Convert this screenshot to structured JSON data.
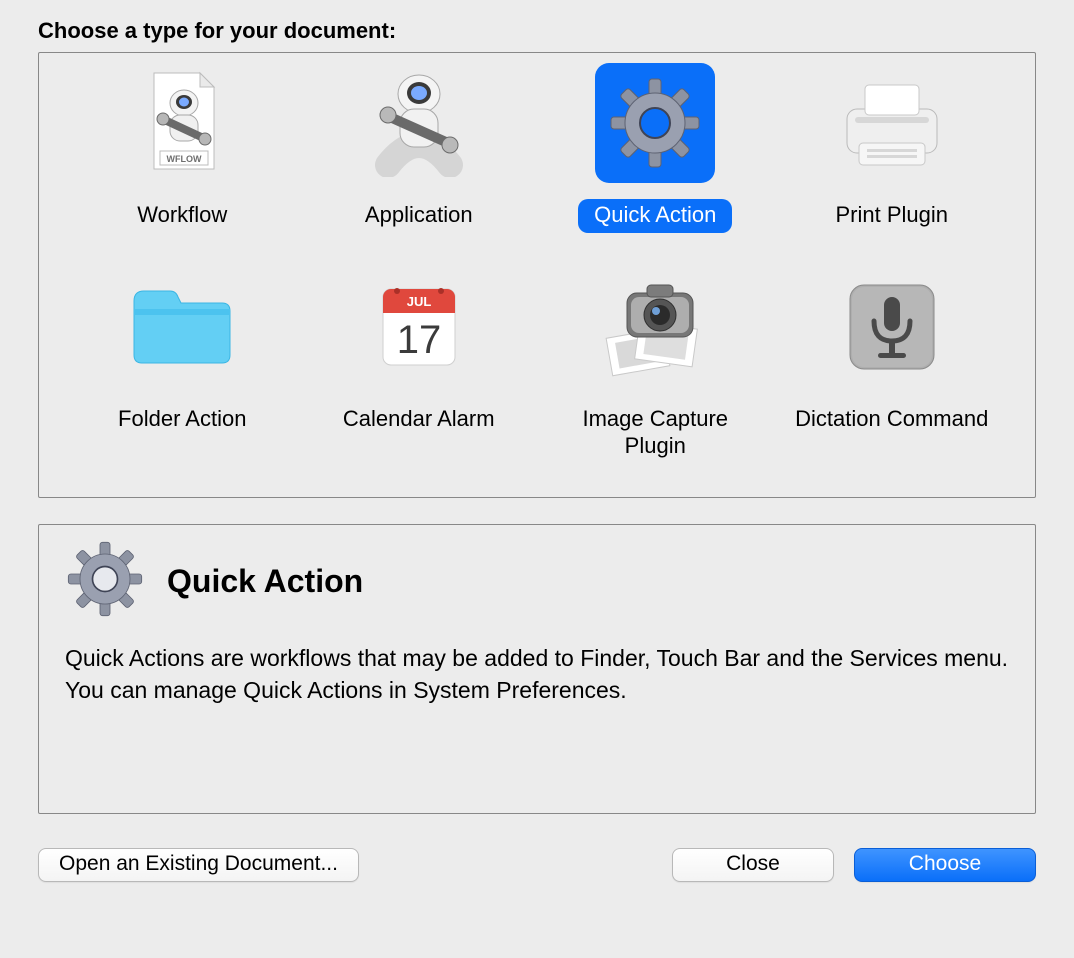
{
  "heading": "Choose a type for your document:",
  "items": [
    {
      "label": "Workflow",
      "icon": "workflow-icon",
      "wflow_tag": "WFLOW"
    },
    {
      "label": "Application",
      "icon": "application-icon"
    },
    {
      "label": "Quick Action",
      "icon": "gear-icon",
      "selected": true
    },
    {
      "label": "Print Plugin",
      "icon": "printer-icon"
    },
    {
      "label": "Folder Action",
      "icon": "folder-icon"
    },
    {
      "label": "Calendar Alarm",
      "icon": "calendar-icon",
      "cal_month": "JUL",
      "cal_day": "17"
    },
    {
      "label": "Image Capture Plugin",
      "icon": "camera-icon"
    },
    {
      "label": "Dictation Command",
      "icon": "microphone-icon"
    }
  ],
  "detail": {
    "title": "Quick Action",
    "description": "Quick Actions are workflows that may be added to Finder, Touch Bar and the Services menu. You can manage Quick Actions in System Preferences."
  },
  "buttons": {
    "open_existing": "Open an Existing Document...",
    "close": "Close",
    "choose": "Choose"
  },
  "colors": {
    "selection": "#0a6ff9",
    "bg": "#ececec"
  }
}
